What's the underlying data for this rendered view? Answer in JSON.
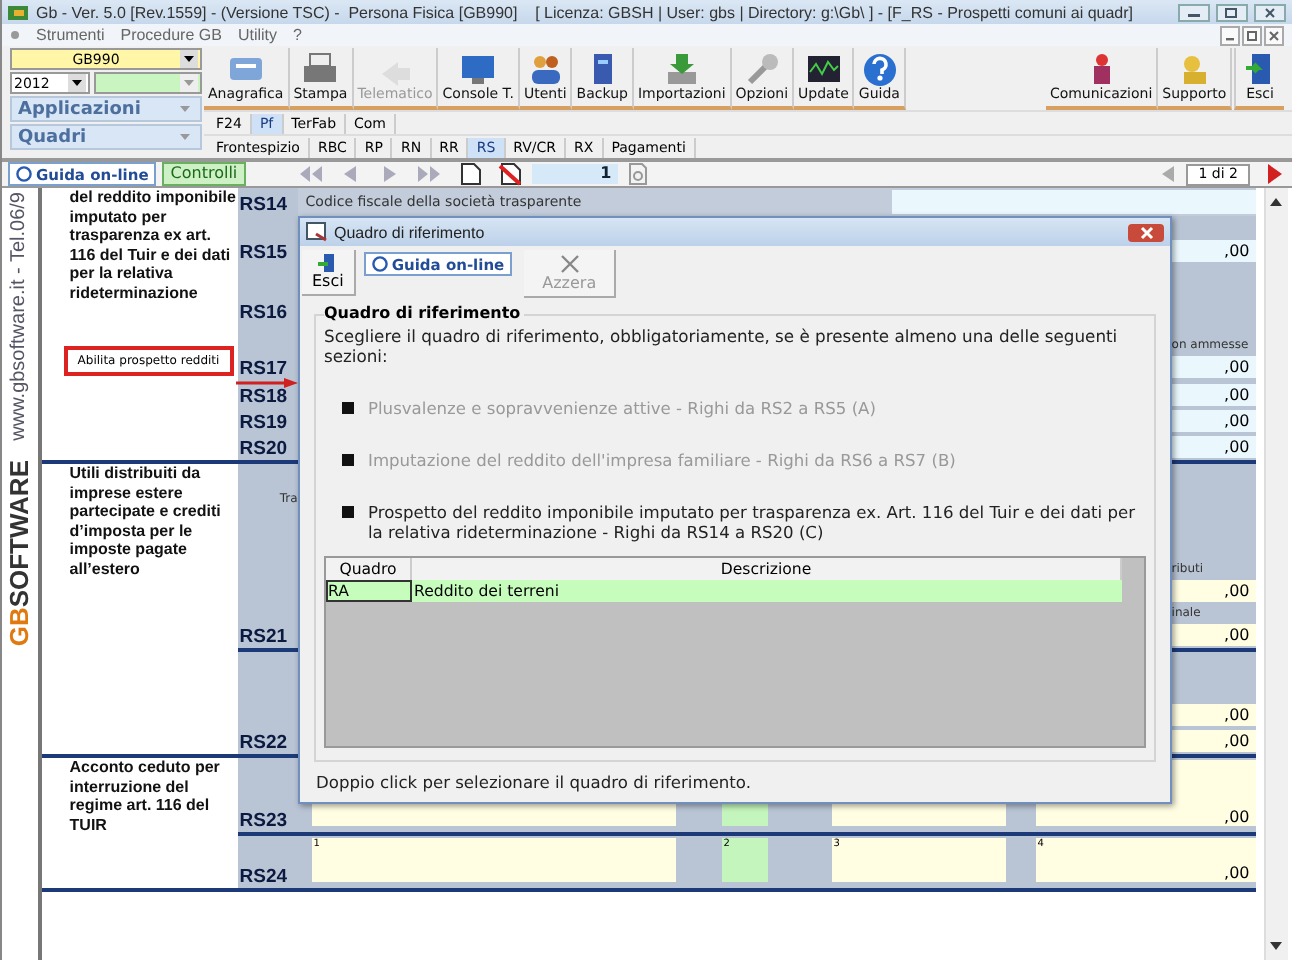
{
  "window": {
    "title": "Gb - Ver. 5.0 [Rev.1559] - (Versione TSC) -  Persona Fisica [GB990]    [ Licenza: GBSH | User: gbs | Directory: g:\\Gb\\ ] - [F_RS - Prospetti comuni ai quadr]"
  },
  "menu": [
    "Strumenti",
    "Procedure GB",
    "Utility",
    "?"
  ],
  "selectors": {
    "code": "GB990",
    "year": "2012"
  },
  "panels": [
    "Applicazioni",
    "Quadri"
  ],
  "toolbar": [
    {
      "label": "Anagrafica",
      "disabled": false
    },
    {
      "label": "Stampa",
      "disabled": false
    },
    {
      "label": "Telematico",
      "disabled": true
    },
    {
      "label": "Console T.",
      "disabled": false
    },
    {
      "label": "Utenti",
      "disabled": false
    },
    {
      "label": "Backup",
      "disabled": false
    },
    {
      "label": "Importazioni",
      "disabled": false
    },
    {
      "label": "Opzioni",
      "disabled": false
    },
    {
      "label": "Update",
      "disabled": false
    },
    {
      "label": "Guida",
      "disabled": false
    }
  ],
  "toolbar_right": [
    {
      "label": "Comunicazioni",
      "disabled": false
    },
    {
      "label": "Supporto",
      "disabled": false
    }
  ],
  "exit_button": "Esci",
  "tabs": [
    {
      "label": "F24",
      "selected": false
    },
    {
      "label": "Pf",
      "selected": true
    },
    {
      "label": "TerFab",
      "selected": false
    },
    {
      "label": "Com",
      "selected": false
    }
  ],
  "quadri_tabs": [
    {
      "label": "Frontespizio",
      "selected": false
    },
    {
      "label": "RBC",
      "selected": false
    },
    {
      "label": "RP",
      "selected": false
    },
    {
      "label": "RN",
      "selected": false
    },
    {
      "label": "RR",
      "selected": false
    },
    {
      "label": "RS",
      "selected": true
    },
    {
      "label": "RV/CR",
      "selected": false
    },
    {
      "label": "RX",
      "selected": false
    },
    {
      "label": "Pagamenti",
      "selected": false
    }
  ],
  "navbar": {
    "help": "Guida on-line",
    "checks": "Controlli",
    "page": "1",
    "page_count": "1 di 2"
  },
  "sidebar": {
    "site": "www.gbsoftware.it - Tel.06/9",
    "logo_mark": "GB",
    "logo_name": "SOFTWARE"
  },
  "sections": [
    {
      "description": "del reddito imponibile imputato per trasparenza ex art. 116 del Tuir e dei dati per la relativa rideterminazione",
      "button": "Abilita prospetto redditi",
      "rows": [
        {
          "code": "RS14",
          "kind": "caption",
          "text": "Codice fiscale della società trasparente"
        },
        {
          "code": "RS15",
          "kind": "stack",
          "items": [
            {
              "kind": "amount",
              "text": ",00"
            }
          ]
        },
        {
          "code": "RS16",
          "kind": "stack",
          "items": []
        },
        {
          "code": "RS17",
          "kind": "stack",
          "items": [
            {
              "kind": "note",
              "text": "on ammesse"
            },
            {
              "kind": "amount",
              "text": ",00"
            }
          ]
        },
        {
          "code": "RS18",
          "kind": "stack",
          "items": [
            {
              "kind": "amount",
              "text": ",00"
            }
          ]
        },
        {
          "code": "RS19",
          "kind": "stack",
          "items": [
            {
              "kind": "amount",
              "text": ",00"
            }
          ]
        },
        {
          "code": "RS20",
          "kind": "stack",
          "items": [
            {
              "kind": "amount",
              "text": ",00"
            }
          ]
        }
      ]
    },
    {
      "description": "Utili distribuiti da imprese estere partecipate e crediti d’imposta per le imposte pagate all’estero",
      "rows": [
        {
          "code": "RS21",
          "kind": "stack",
          "side_note": "Tra",
          "items": [
            {
              "kind": "note",
              "text": "ributi"
            },
            {
              "kind": "amount",
              "text": ",00"
            },
            {
              "kind": "note",
              "text": "inale"
            },
            {
              "kind": "amount",
              "text": ",00"
            }
          ]
        },
        {
          "code": "RS22",
          "kind": "stack",
          "items": [
            {
              "kind": "amount",
              "text": ",00"
            },
            {
              "kind": "amount",
              "text": ",00"
            }
          ]
        }
      ]
    },
    {
      "description": "Acconto ceduto per interruzione del regime art. 116 del TUIR",
      "rows": [
        {
          "code": "RS23",
          "kind": "line",
          "fields": [
            {
              "color": "#fffde2"
            },
            {
              "color": "#c4f5bc"
            },
            {
              "color": "#fffde2"
            },
            {
              "color": "#fffde2",
              "value": ",00"
            }
          ]
        },
        {
          "code": "RS24",
          "kind": "line",
          "fields": [
            {
              "number": "1",
              "color": "#fffde2"
            },
            {
              "number": "2",
              "color": "#c4f5bc"
            },
            {
              "number": "3",
              "color": "#fffde2"
            },
            {
              "number": "4",
              "color": "#fffde2",
              "value": ",00"
            }
          ]
        }
      ]
    }
  ],
  "dialog": {
    "title": "Quadro di riferimento",
    "toolbar": [
      {
        "kind": "button",
        "label": "Esci",
        "disabled": false
      },
      {
        "kind": "link",
        "label": "Guida on-line"
      },
      {
        "kind": "button",
        "label": "Azzera",
        "disabled": true
      }
    ],
    "group_title": "Quadro di riferimento",
    "intro": "Scegliere il quadro di riferimento, obbligatoriamente, se è presente almeno una delle seguenti sezioni:",
    "options": [
      {
        "text": "Plusvalenze e sopravvenienze attive - Righi da RS2 a RS5 (A)",
        "enabled": false
      },
      {
        "text": "Imputazione del reddito dell'impresa familiare - Righi da RS6 a RS7 (B)",
        "enabled": false
      },
      {
        "text": "Prospetto del reddito imponibile imputato per trasparenza ex. Art. 116 del Tuir e dei dati per la relativa rideterminazione - Righi da RS14 a RS20 (C)",
        "enabled": true
      }
    ],
    "table": {
      "columns": [
        "Quadro",
        "Descrizione"
      ],
      "rows": [
        {
          "cells": [
            "RA",
            "Reddito dei terreni"
          ],
          "selected": true
        }
      ]
    },
    "hint": "Doppio click per selezionare il quadro di riferimento."
  }
}
